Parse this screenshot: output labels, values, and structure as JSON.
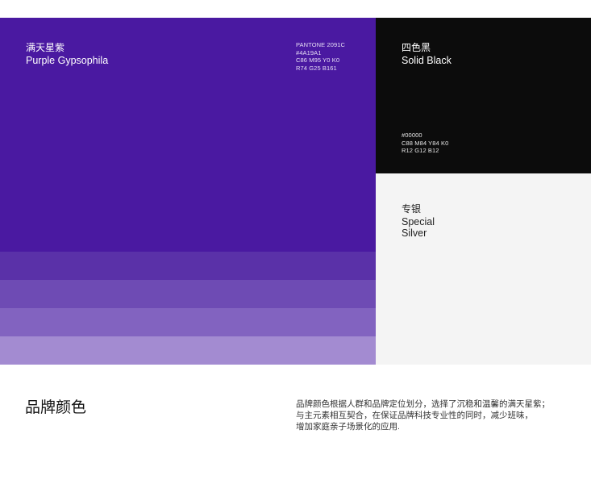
{
  "palette": {
    "primary": {
      "name_cn": "满天星紫",
      "name_en": "Purple Gypsophila",
      "color": "#4A19A1",
      "tints": [
        "#5a31a8",
        "#6e4bb4",
        "#8263c0",
        "#a38bd1"
      ],
      "specs": [
        "PANTONE 2091C",
        "#4A19A1",
        "C86 M95 Y0 K0",
        "R74 G25 B161"
      ]
    },
    "black": {
      "name_cn": "四色黑",
      "name_en": "Solid Black",
      "color": "#0C0C0C",
      "specs": [
        "#00000",
        "C88 M84 Y84 K0",
        "R12 G12 B12"
      ]
    },
    "silver": {
      "name_cn": "专银",
      "name_en_lines": [
        "Special",
        "Silver"
      ],
      "color": "#F4F4F4"
    }
  },
  "section": {
    "title": "品牌颜色",
    "description_lines": [
      "品牌颜色根据人群和品牌定位划分，选择了沉稳和温馨的满天星紫；",
      "与主元素相互契合，在保证品牌科技专业性的同时，减少班味，",
      "增加家庭亲子场景化的应用."
    ]
  }
}
